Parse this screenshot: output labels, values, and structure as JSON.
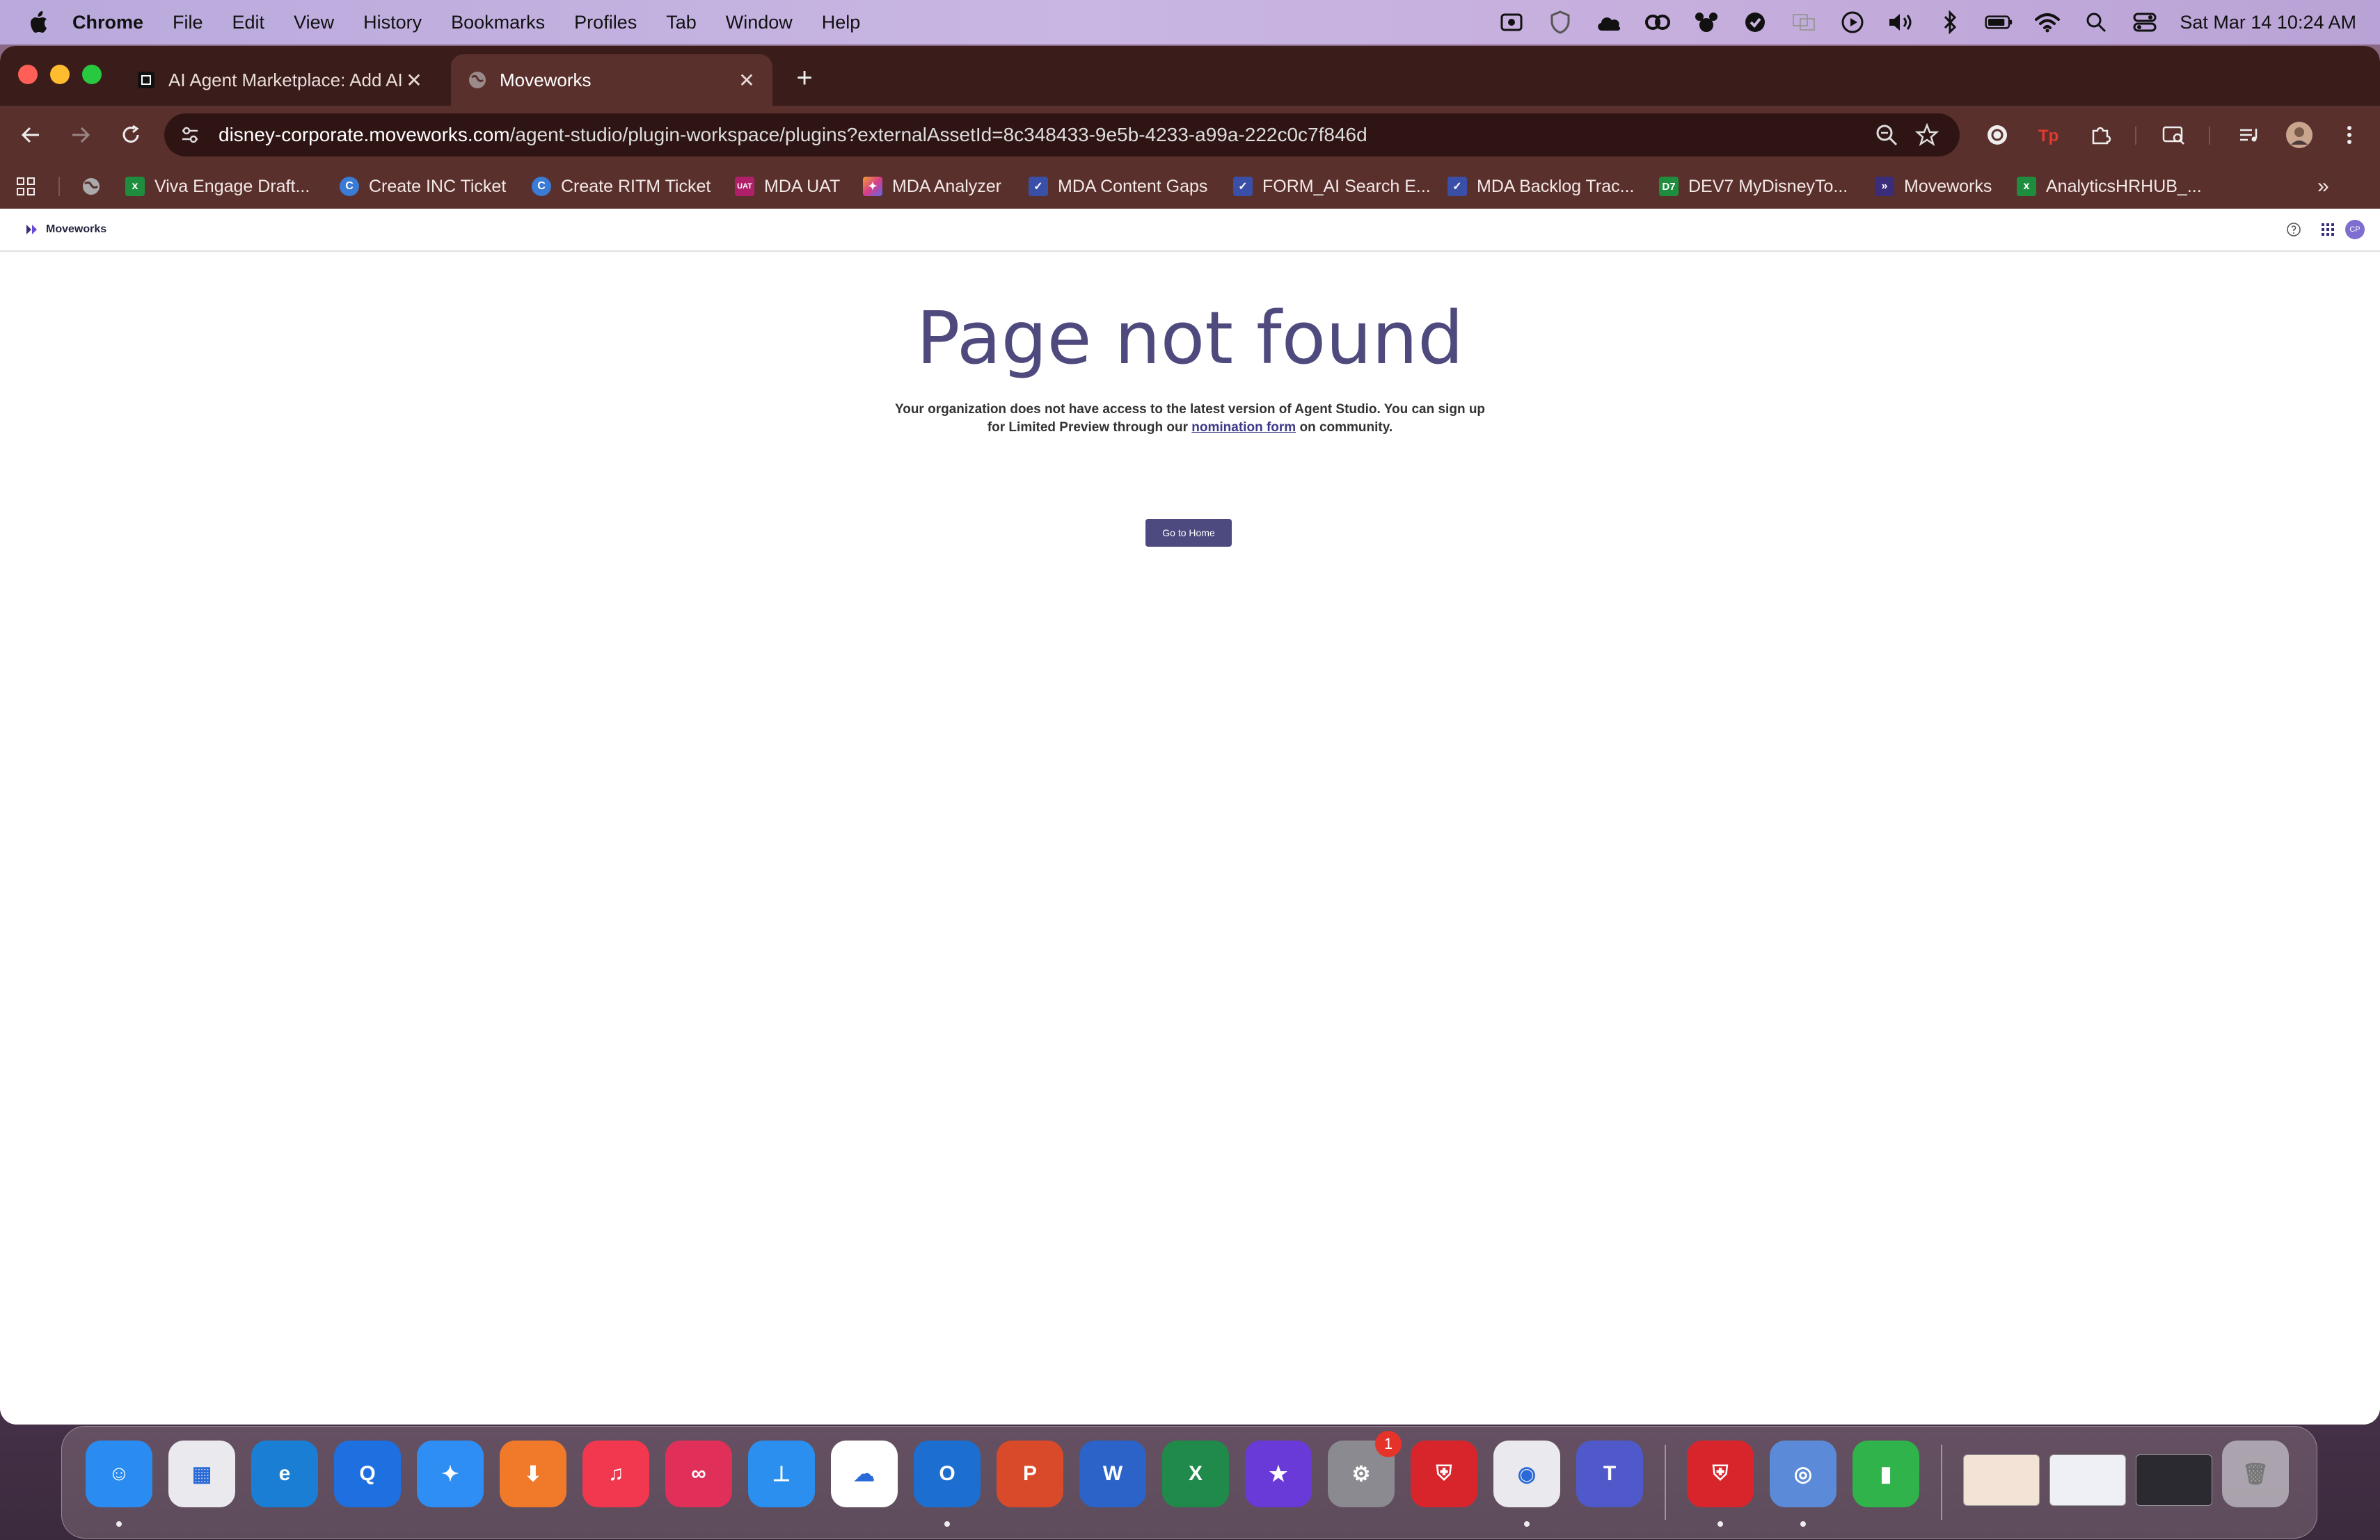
{
  "menubar": {
    "app": "Chrome",
    "items": [
      "File",
      "Edit",
      "View",
      "History",
      "Bookmarks",
      "Profiles",
      "Tab",
      "Window",
      "Help"
    ],
    "clock": "Sat Mar 14  10:24 AM"
  },
  "tabs": [
    {
      "title": "AI Agent Marketplace: Add AI",
      "active": false
    },
    {
      "title": "Moveworks",
      "active": true
    }
  ],
  "address": {
    "host": "disney-corporate.moveworks.com",
    "path": "/agent-studio/plugin-workspace/plugins?externalAssetId=8c348433-9e5b-4233-a99a-222c0c7f846d"
  },
  "bookmarks": [
    {
      "label": "Viva Engage Draft...",
      "icon": "sheets-icon",
      "color": "#1e8e3e",
      "glyph": "x"
    },
    {
      "label": "Create INC Ticket",
      "icon": "servicenow-icon",
      "color": "#3a7bd5",
      "glyph": "C"
    },
    {
      "label": "Create RITM Ticket",
      "icon": "servicenow-icon",
      "color": "#3a7bd5",
      "glyph": "C"
    },
    {
      "label": "MDA UAT",
      "icon": "uat-icon",
      "color": "#b0206a",
      "glyph": "UAT"
    },
    {
      "label": "MDA Analyzer",
      "icon": "copilot-icon",
      "color": "#8a4fd8",
      "glyph": "✦"
    },
    {
      "label": "MDA Content Gaps",
      "icon": "checkmark-icon",
      "color": "#3a4fa8",
      "glyph": "✓"
    },
    {
      "label": "FORM_AI Search E...",
      "icon": "checkmark-icon",
      "color": "#3a4fa8",
      "glyph": "✓"
    },
    {
      "label": "MDA Backlog Trac...",
      "icon": "checkmark-icon",
      "color": "#3a4fa8",
      "glyph": "✓"
    },
    {
      "label": "DEV7 MyDisneyTo...",
      "icon": "d7-icon",
      "color": "#1e8e3e",
      "glyph": "D7"
    },
    {
      "label": "Moveworks",
      "icon": "moveworks-icon",
      "color": "#3b2d7a",
      "glyph": "»"
    },
    {
      "label": "AnalyticsHRHUB_...",
      "icon": "sheets-icon",
      "color": "#1e8e3e",
      "glyph": "x"
    }
  ],
  "app": {
    "brand": "Moveworks",
    "avatar": "CP"
  },
  "notfound": {
    "title": "Page not found",
    "msg_before": "Your organization does not have access to the latest version of Agent Studio. You can sign up for Limited Preview through our ",
    "link": "nomination form",
    "msg_after": " on community.",
    "button": "Go to Home"
  },
  "dock": {
    "settings_badge": "1",
    "apps": [
      {
        "name": "finder",
        "color": "#2a8cf0",
        "glyph": "☺"
      },
      {
        "name": "launchpad",
        "color": "#e9e9ee",
        "glyph": "▦"
      },
      {
        "name": "edge",
        "color": "#1a7fd4",
        "glyph": "e"
      },
      {
        "name": "quicktime",
        "color": "#1e6fe0",
        "glyph": "Q"
      },
      {
        "name": "safari",
        "color": "#2f8ef3",
        "glyph": "✦"
      },
      {
        "name": "downloads",
        "color": "#f07a2a",
        "glyph": "⬇"
      },
      {
        "name": "music",
        "color": "#f2384e",
        "glyph": "♫"
      },
      {
        "name": "creative-cloud",
        "color": "#e0305a",
        "glyph": "∞"
      },
      {
        "name": "keynote",
        "color": "#2b8ff0",
        "glyph": "⊥"
      },
      {
        "name": "onedrive",
        "color": "#ffffff",
        "glyph": "☁"
      },
      {
        "name": "outlook",
        "color": "#1c6fd0",
        "glyph": "O"
      },
      {
        "name": "powerpoint",
        "color": "#d84a2a",
        "glyph": "P"
      },
      {
        "name": "word",
        "color": "#2b63c8",
        "glyph": "W"
      },
      {
        "name": "excel",
        "color": "#1f8a4a",
        "glyph": "X"
      },
      {
        "name": "imovie",
        "color": "#6a3ad8",
        "glyph": "★"
      },
      {
        "name": "system-settings",
        "color": "#8a8a90",
        "glyph": "⚙"
      },
      {
        "name": "vpn-shield",
        "color": "#d8252c",
        "glyph": "⛨"
      },
      {
        "name": "chrome",
        "color": "#e9e9ee",
        "glyph": "◉"
      },
      {
        "name": "teams",
        "color": "#5059c9",
        "glyph": "T"
      },
      {
        "name": "vpn-shield-2",
        "color": "#d8252c",
        "glyph": "⛨"
      },
      {
        "name": "disk-utility",
        "color": "#5a8ad8",
        "glyph": "◎"
      },
      {
        "name": "numbers",
        "color": "#2fb34a",
        "glyph": "▮"
      }
    ]
  }
}
